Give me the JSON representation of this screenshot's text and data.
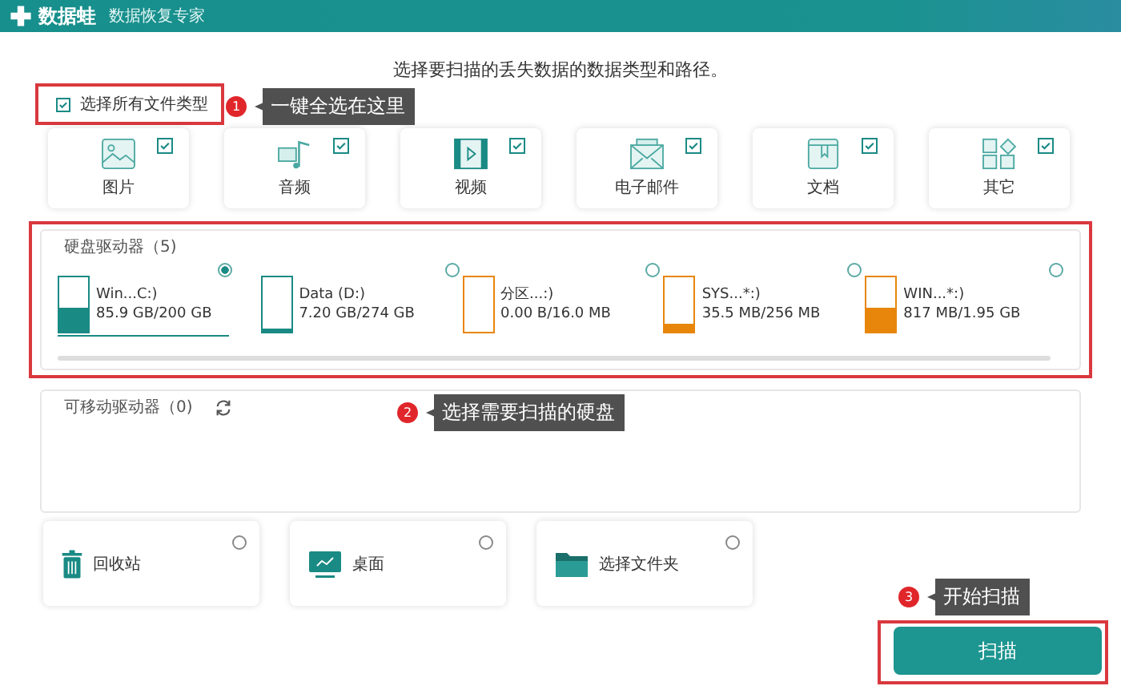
{
  "app": {
    "name": "数据蛙",
    "subtitle": "数据恢复专家"
  },
  "heading": "选择要扫描的丢失数据的数据类型和路径。",
  "select_all": {
    "label": "选择所有文件类型",
    "checked": true
  },
  "file_types": [
    {
      "kind": "image",
      "label": "图片",
      "checked": true
    },
    {
      "kind": "audio",
      "label": "音频",
      "checked": true
    },
    {
      "kind": "video",
      "label": "视频",
      "checked": true
    },
    {
      "kind": "email",
      "label": "电子邮件",
      "checked": true
    },
    {
      "kind": "document",
      "label": "文档",
      "checked": true
    },
    {
      "kind": "other",
      "label": "其它",
      "checked": true
    }
  ],
  "hard_drives": {
    "title": "硬盘驱动器（5)",
    "drives": [
      {
        "name": "Win...C:)",
        "size": "85.9 GB/200 GB",
        "level": 0.43,
        "color": "#1a8a84",
        "selected": true
      },
      {
        "name": "Data (D:)",
        "size": "7.20 GB/274 GB",
        "level": 0.03,
        "color": "#1a8a84",
        "selected": false
      },
      {
        "name": "分区...:)",
        "size": "0.00  B/16.0 MB",
        "level": 0,
        "color": "#e8860c",
        "selected": false
      },
      {
        "name": "SYS...*:)",
        "size": "35.5 MB/256 MB",
        "level": 0.14,
        "color": "#e8860c",
        "selected": false
      },
      {
        "name": "WIN...*:)",
        "size": "817 MB/1.95 GB",
        "level": 0.42,
        "color": "#e8860c",
        "selected": false
      }
    ]
  },
  "removable_drives": {
    "title": "可移动驱动器（0)"
  },
  "locations": [
    {
      "kind": "recycle-bin",
      "label": "回收站",
      "selected": false
    },
    {
      "kind": "desktop",
      "label": "桌面",
      "selected": false
    },
    {
      "kind": "folder",
      "label": "选择文件夹",
      "selected": false
    }
  ],
  "annotations": [
    {
      "number": "1",
      "text": "一键全选在这里"
    },
    {
      "number": "2",
      "text": "选择需要扫描的硬盘"
    },
    {
      "number": "3",
      "text": "开始扫描"
    }
  ],
  "scan_button": "扫描"
}
